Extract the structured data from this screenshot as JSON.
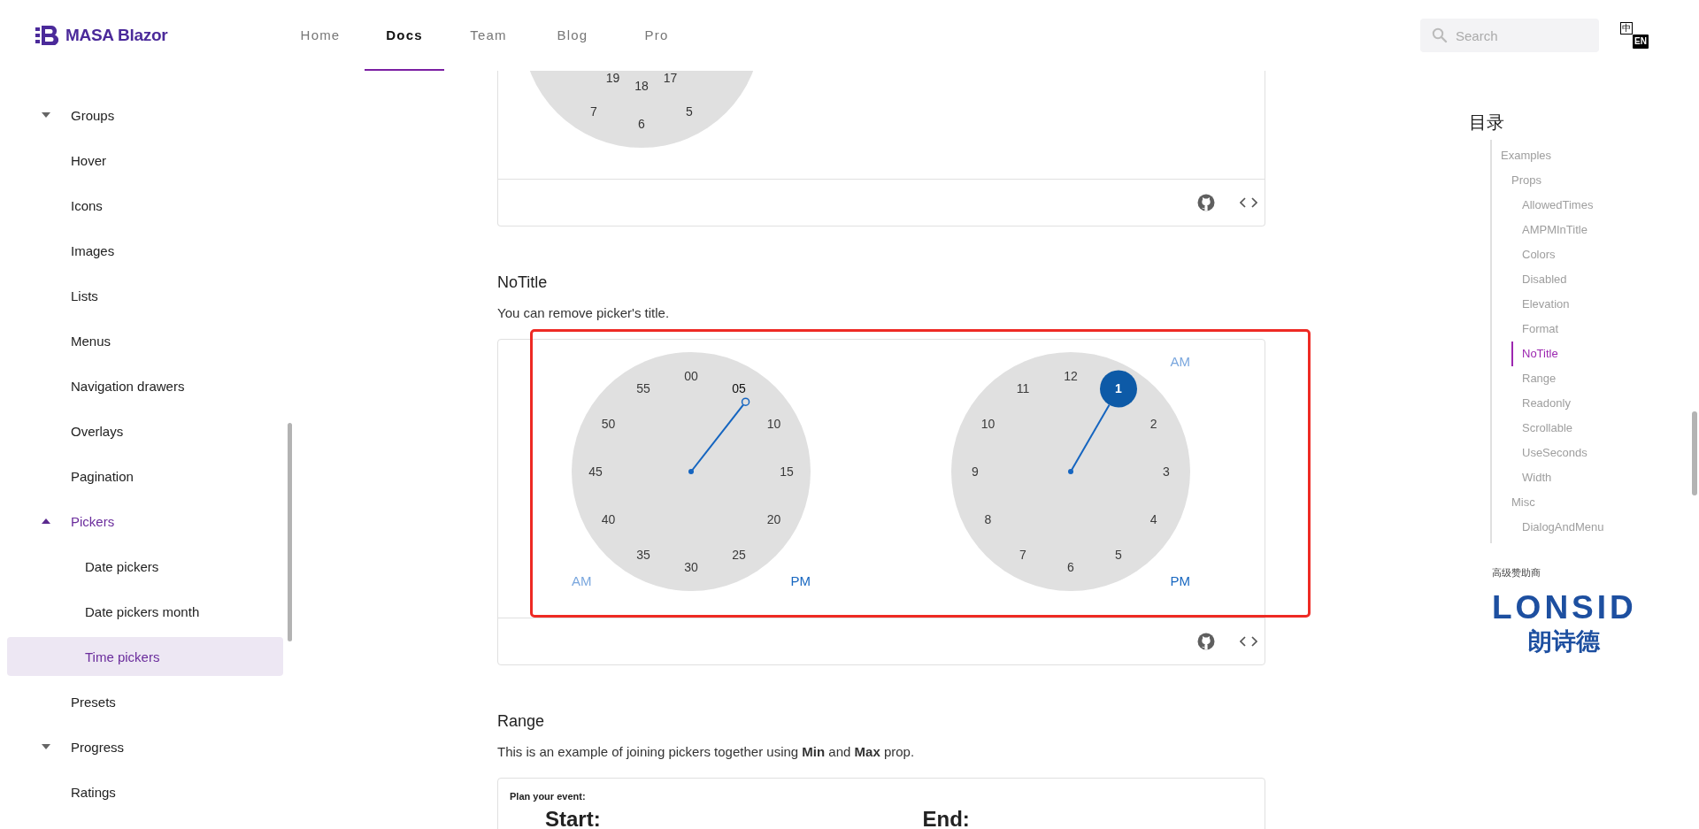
{
  "header": {
    "logo": {
      "text": "MASA Blazor"
    },
    "nav": [
      {
        "label": "Home",
        "selected": false
      },
      {
        "label": "Docs",
        "selected": true
      },
      {
        "label": "Team",
        "selected": false
      },
      {
        "label": "Blog",
        "selected": false
      },
      {
        "label": "Pro",
        "selected": false
      }
    ],
    "search": {
      "placeholder": "Search"
    },
    "language_toggle": {
      "primary": "中",
      "secondary": "EN"
    }
  },
  "sidebar": {
    "items": [
      {
        "label": "Groups",
        "kind": "group",
        "expanded": false,
        "selected": false
      },
      {
        "label": "Hover",
        "kind": "page",
        "selected": false
      },
      {
        "label": "Icons",
        "kind": "page",
        "selected": false
      },
      {
        "label": "Images",
        "kind": "page",
        "selected": false
      },
      {
        "label": "Lists",
        "kind": "page",
        "selected": false
      },
      {
        "label": "Menus",
        "kind": "page",
        "selected": false
      },
      {
        "label": "Navigation drawers",
        "kind": "page",
        "selected": false
      },
      {
        "label": "Overlays",
        "kind": "page",
        "selected": false
      },
      {
        "label": "Pagination",
        "kind": "page",
        "selected": false
      },
      {
        "label": "Pickers",
        "kind": "group",
        "expanded": true,
        "selected": false,
        "children": [
          {
            "label": "Date pickers",
            "kind": "page",
            "selected": false
          },
          {
            "label": "Date pickers month",
            "kind": "page",
            "selected": false
          },
          {
            "label": "Time pickers",
            "kind": "page",
            "selected": true
          }
        ]
      },
      {
        "label": "Presets",
        "kind": "page",
        "selected": false
      },
      {
        "label": "Progress",
        "kind": "group",
        "expanded": false,
        "selected": false
      },
      {
        "label": "Ratings",
        "kind": "page",
        "selected": false
      }
    ]
  },
  "content": [
    {
      "kind": "card",
      "preview": {
        "kind": "dial24-partial",
        "numbers": [
          "19",
          "18",
          "17",
          "7",
          "6",
          "5"
        ]
      }
    },
    {
      "kind": "heading",
      "text": "NoTitle"
    },
    {
      "kind": "paragraph",
      "text": "You can remove picker's title."
    },
    {
      "kind": "card",
      "highlighted": true,
      "preview": {
        "kind": "pickers",
        "pickers": [
          {
            "kind": "minutes",
            "numbers": [
              {
                "label": "00",
                "selected": false
              },
              {
                "label": "05",
                "selected": true
              },
              {
                "label": "10",
                "selected": false
              },
              {
                "label": "15",
                "selected": false
              },
              {
                "label": "20",
                "selected": false
              },
              {
                "label": "25",
                "selected": false
              },
              {
                "label": "30",
                "selected": false
              },
              {
                "label": "35",
                "selected": false
              },
              {
                "label": "40",
                "selected": false
              },
              {
                "label": "45",
                "selected": false
              },
              {
                "label": "50",
                "selected": false
              },
              {
                "label": "55",
                "selected": false
              }
            ],
            "periods": [
              {
                "label": "AM",
                "selected": false
              },
              {
                "label": "PM",
                "selected": true
              }
            ]
          },
          {
            "kind": "hours",
            "numbers": [
              {
                "label": "12",
                "selected": false
              },
              {
                "label": "1",
                "selected": true
              },
              {
                "label": "2",
                "selected": false
              },
              {
                "label": "3",
                "selected": false
              },
              {
                "label": "4",
                "selected": false
              },
              {
                "label": "5",
                "selected": false
              },
              {
                "label": "6",
                "selected": false
              },
              {
                "label": "7",
                "selected": false
              },
              {
                "label": "8",
                "selected": false
              },
              {
                "label": "9",
                "selected": false
              },
              {
                "label": "10",
                "selected": false
              },
              {
                "label": "11",
                "selected": false
              }
            ],
            "periods": [
              {
                "label": "AM",
                "selected": false
              },
              {
                "label": "PM",
                "selected": true
              }
            ]
          }
        ]
      }
    },
    {
      "kind": "heading",
      "text": "Range"
    },
    {
      "kind": "paragraph",
      "text": "This is an example of joining pickers together using **Min** and **Max** prop."
    },
    {
      "kind": "card",
      "preview": {
        "kind": "range",
        "caption": "Plan your event:",
        "labels": [
          "Start:",
          "End:"
        ]
      }
    }
  ],
  "toc": {
    "title": "目录",
    "items": [
      {
        "label": "Examples",
        "selected": false,
        "children": [
          {
            "label": "Props",
            "selected": false,
            "children": [
              {
                "label": "AllowedTimes",
                "selected": false
              },
              {
                "label": "AMPMInTitle",
                "selected": false
              },
              {
                "label": "Colors",
                "selected": false
              },
              {
                "label": "Disabled",
                "selected": false
              },
              {
                "label": "Elevation",
                "selected": false
              },
              {
                "label": "Format",
                "selected": false
              },
              {
                "label": "NoTitle",
                "selected": true
              },
              {
                "label": "Range",
                "selected": false
              },
              {
                "label": "Readonly",
                "selected": false
              },
              {
                "label": "Scrollable",
                "selected": false
              },
              {
                "label": "UseSeconds",
                "selected": false
              },
              {
                "label": "Width",
                "selected": false
              }
            ]
          },
          {
            "label": "Misc",
            "selected": false,
            "children": [
              {
                "label": "DialogAndMenu",
                "selected": false
              }
            ]
          }
        ]
      }
    ]
  },
  "sponsor": {
    "label": "高级赞助商",
    "logo_text": "LONSID",
    "logo_subtext": "朗诗德"
  }
}
